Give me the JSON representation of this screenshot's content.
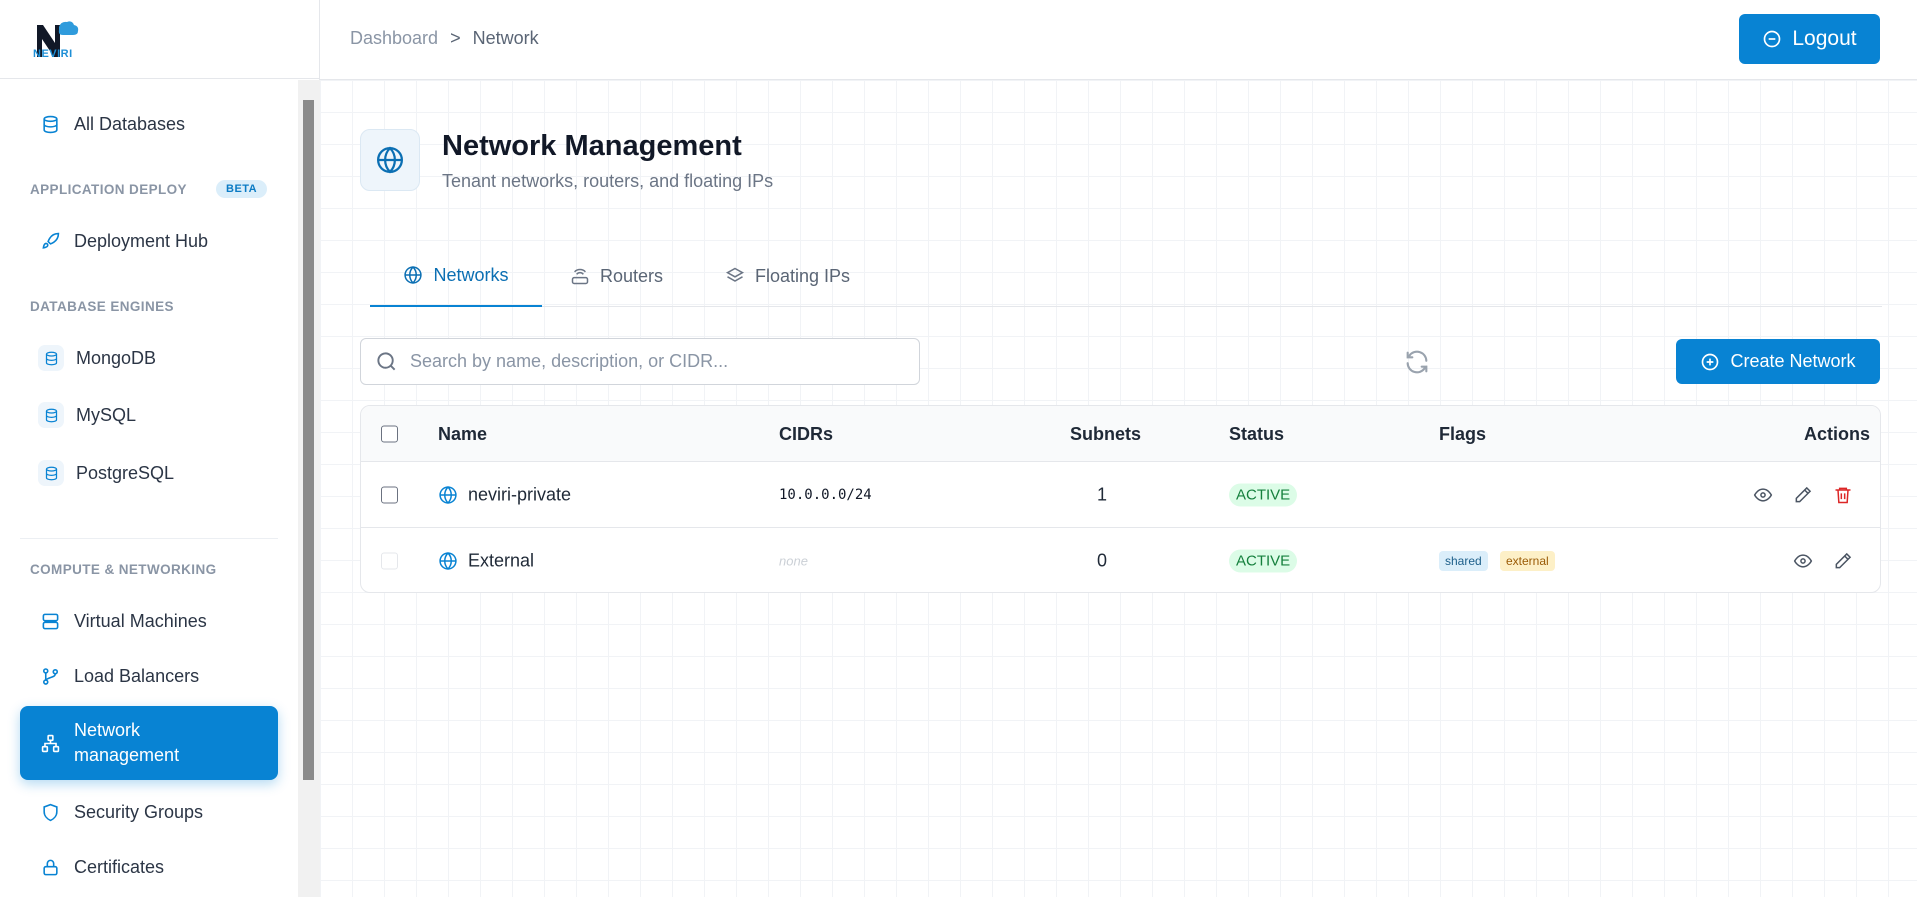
{
  "brand": {
    "name": "NEVIRI"
  },
  "sidebar": {
    "all_databases": "All Databases",
    "section_app_deploy": "APPLICATION DEPLOY",
    "beta_badge": "BETA",
    "deployment_hub": "Deployment Hub",
    "section_db_engines": "DATABASE ENGINES",
    "engines": [
      "MongoDB",
      "MySQL",
      "PostgreSQL"
    ],
    "section_compute": "COMPUTE & NETWORKING",
    "compute": [
      "Virtual Machines",
      "Load Balancers",
      "Network management",
      "Security Groups",
      "Certificates"
    ]
  },
  "header": {
    "breadcrumb": [
      "Dashboard",
      ">",
      "Network"
    ],
    "logout_label": "Logout"
  },
  "page": {
    "title": "Network Management",
    "subtitle": "Tenant networks, routers, and floating IPs"
  },
  "tabs": [
    "Networks",
    "Routers",
    "Floating IPs"
  ],
  "search": {
    "placeholder": "Search by name, description, or CIDR..."
  },
  "create_label": "Create Network",
  "table": {
    "headers": [
      "Name",
      "CIDRs",
      "Subnets",
      "Status",
      "Flags",
      "Actions"
    ],
    "rows": [
      {
        "name": "neviri-private",
        "cidr": "10.0.0.0/24",
        "subnets": "1",
        "status": "ACTIVE",
        "flags": []
      },
      {
        "name": "External",
        "cidr": "none",
        "subnets": "0",
        "status": "ACTIVE",
        "flags": [
          "shared",
          "external"
        ]
      }
    ]
  },
  "colors": {
    "accent": "#0883d3",
    "status_active_bg": "#dcfce7",
    "danger": "#dc2626"
  }
}
